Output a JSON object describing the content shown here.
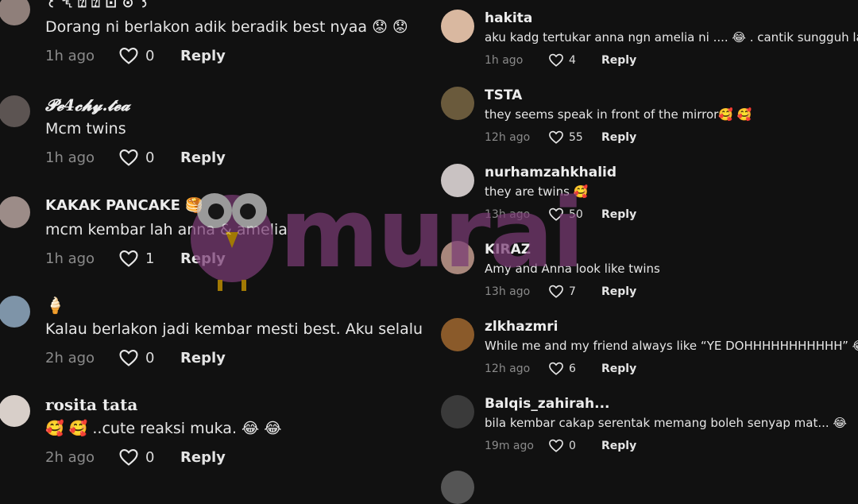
{
  "left_comments": [
    {
      "username": "꒰ ␡ ⍰ ⍰ ⊡ ⊙ ꒱",
      "text": "Dorang ni berlakon adik beradik best nyaa 😟 😟",
      "time": "1h ago",
      "likes": "0",
      "reply": "Reply",
      "avatar_color": "#8f7f7a"
    },
    {
      "username": "𝓟𝓮4𝓬𝓱𝔂.𝓽𝓮𝓪",
      "text": "Mcm twins",
      "time": "1h ago",
      "likes": "0",
      "reply": "Reply",
      "avatar_color": "#5c5452"
    },
    {
      "username": "KAKAK PANCAKE 🥞",
      "text": "mcm kembar lah anna & amelia",
      "time": "1h ago",
      "likes": "1",
      "reply": "Reply",
      "avatar_color": "#9c8c88"
    },
    {
      "username": "🍦",
      "text": "Kalau berlakon jadi kembar mesti best. Aku selalu",
      "time": "2h ago",
      "likes": "0",
      "reply": "Reply",
      "avatar_color": "#7e94a8"
    },
    {
      "username": "rosita tata",
      "text": "🥰 🥰 ..cute reaksi muka. 😂 😂",
      "time": "2h ago",
      "likes": "0",
      "reply": "Reply",
      "avatar_color": "#d8cfc9"
    }
  ],
  "right_comments": [
    {
      "username": "hakita",
      "text": "aku kadg tertukar anna ngn amelia ni .... 😂 . cantik sungguh la...",
      "time": "1h ago",
      "likes": "4",
      "reply": "Reply",
      "avatar_color": "#d9b8a0"
    },
    {
      "username": "TSTA",
      "text": "they seems speak in front of the mirror🥰 🥰",
      "time": "12h ago",
      "likes": "55",
      "reply": "Reply",
      "avatar_color": "#6a5a3c"
    },
    {
      "username": "nurhamzahkhalid",
      "text": "they are twins 🥰",
      "time": "13h ago",
      "likes": "50",
      "reply": "Reply",
      "avatar_color": "#c9c2c2"
    },
    {
      "username": "KIRAZ",
      "text": "Amy and Anna look like twins",
      "time": "13h ago",
      "likes": "7",
      "reply": "Reply",
      "avatar_color": "#a8877c"
    },
    {
      "username": "zlkhazmri",
      "text": "While me and my friend always like “YE DOHHHHHHHHHHH” 😂",
      "time": "12h ago",
      "likes": "6",
      "reply": "Reply",
      "avatar_color": "#8a5a2a"
    },
    {
      "username": "Balqis_zahirah...",
      "text": "bila kembar cakap serentak memang boleh senyap mat... 😂",
      "time": "19m ago",
      "likes": "0",
      "reply": "Reply",
      "avatar_color": "#3a3a3a"
    }
  ],
  "watermark": {
    "text": "murai",
    "color": "#7a3b74"
  }
}
